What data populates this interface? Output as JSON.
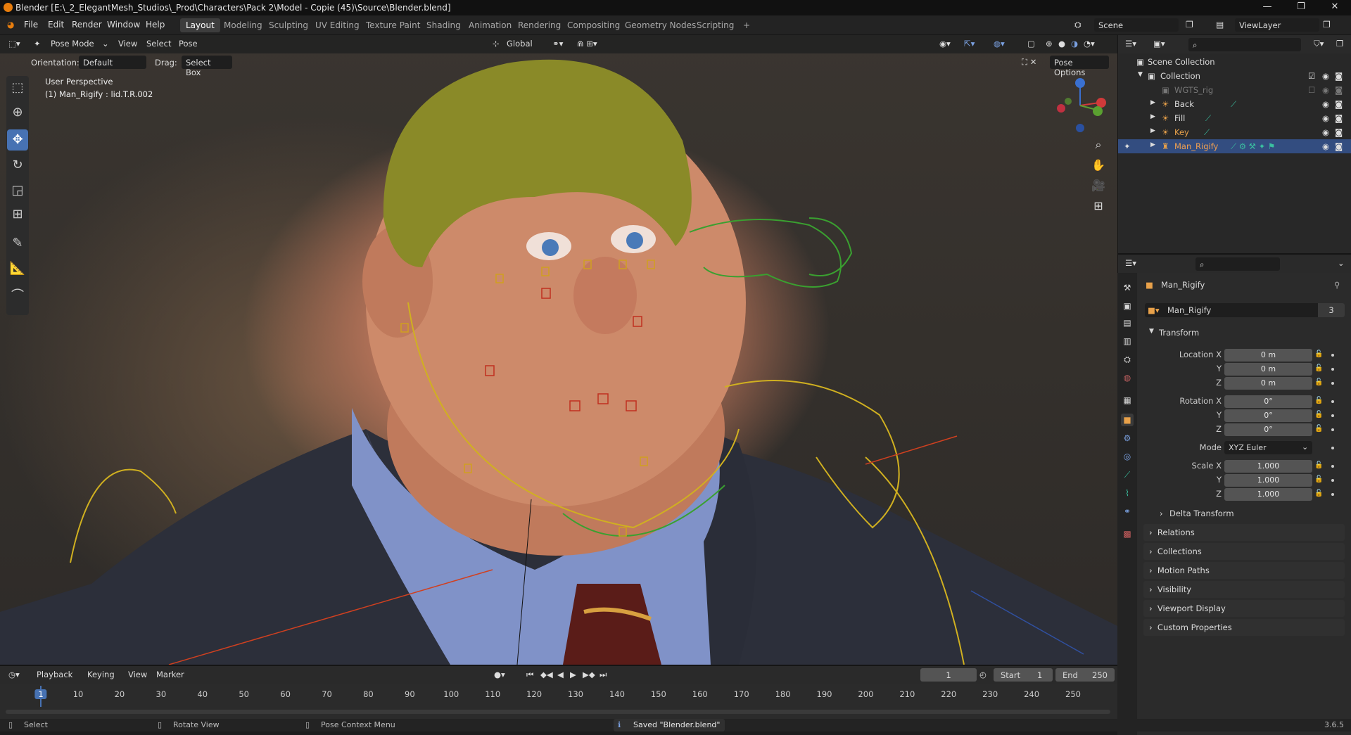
{
  "window": {
    "title": "Blender [E:\\_2_ElegantMesh_Studios\\_Prod\\Characters\\Pack 2\\Model - Copie (45)\\Source\\Blender.blend]"
  },
  "menus": [
    "File",
    "Edit",
    "Render",
    "Window",
    "Help"
  ],
  "workspaces": [
    "Layout",
    "Modeling",
    "Sculpting",
    "UV Editing",
    "Texture Paint",
    "Shading",
    "Animation",
    "Rendering",
    "Compositing",
    "Geometry Nodes",
    "Scripting"
  ],
  "active_workspace": "Layout",
  "scene": {
    "name": "Scene",
    "view_layer": "ViewLayer"
  },
  "viewport": {
    "mode": "Pose Mode",
    "menus": [
      "View",
      "Select",
      "Pose"
    ],
    "transform_orientation": "Global",
    "orientation_label": "Orientation:",
    "orientation_value": "Default",
    "drag_label": "Drag:",
    "drag_value": "Select Box",
    "pose_options": "Pose Options",
    "overlay_line1": "User Perspective",
    "overlay_line2": "(1) Man_Rigify : lid.T.R.002"
  },
  "outliner": {
    "root": "Scene Collection",
    "items": [
      {
        "label": "Collection",
        "level": 1
      },
      {
        "label": "WGTS_rig",
        "level": 2
      },
      {
        "label": "Back",
        "level": 2
      },
      {
        "label": "Fill",
        "level": 2
      },
      {
        "label": "Key",
        "level": 2
      },
      {
        "label": "Man_Rigify",
        "level": 2
      }
    ]
  },
  "properties": {
    "object_name": "Man_Rigify",
    "data_name": "Man_Rigify",
    "users": "3",
    "transform_title": "Transform",
    "location": {
      "label": "Location X",
      "x": "0 m",
      "y": "0 m",
      "z": "0 m"
    },
    "rotation": {
      "label": "Rotation X",
      "x": "0°",
      "y": "0°",
      "z": "0°"
    },
    "mode_label": "Mode",
    "mode_value": "XYZ Euler",
    "scale": {
      "label": "Scale X",
      "x": "1.000",
      "y": "1.000",
      "z": "1.000"
    },
    "axis_y": "Y",
    "axis_z": "Z",
    "delta": "Delta Transform",
    "panels": [
      "Relations",
      "Collections",
      "Motion Paths",
      "Visibility",
      "Viewport Display",
      "Custom Properties"
    ]
  },
  "timeline": {
    "menus": [
      "Playback",
      "Keying",
      "View",
      "Marker"
    ],
    "current_frame": "1",
    "start_label": "Start",
    "start": "1",
    "end_label": "End",
    "end": "250",
    "ticks": [
      "1",
      "10",
      "20",
      "30",
      "40",
      "50",
      "60",
      "70",
      "80",
      "90",
      "100",
      "110",
      "120",
      "130",
      "140",
      "150",
      "160",
      "170",
      "180",
      "190",
      "200",
      "210",
      "220",
      "230",
      "240",
      "250"
    ]
  },
  "status": {
    "select": "Select",
    "rotate": "Rotate View",
    "context": "Pose Context Menu",
    "saved": "Saved \"Blender.blend\"",
    "version": "3.6.5"
  },
  "colors": {
    "accent": "#4772b3",
    "selected_row": "#334d80",
    "key_light": "#e8a14a"
  }
}
